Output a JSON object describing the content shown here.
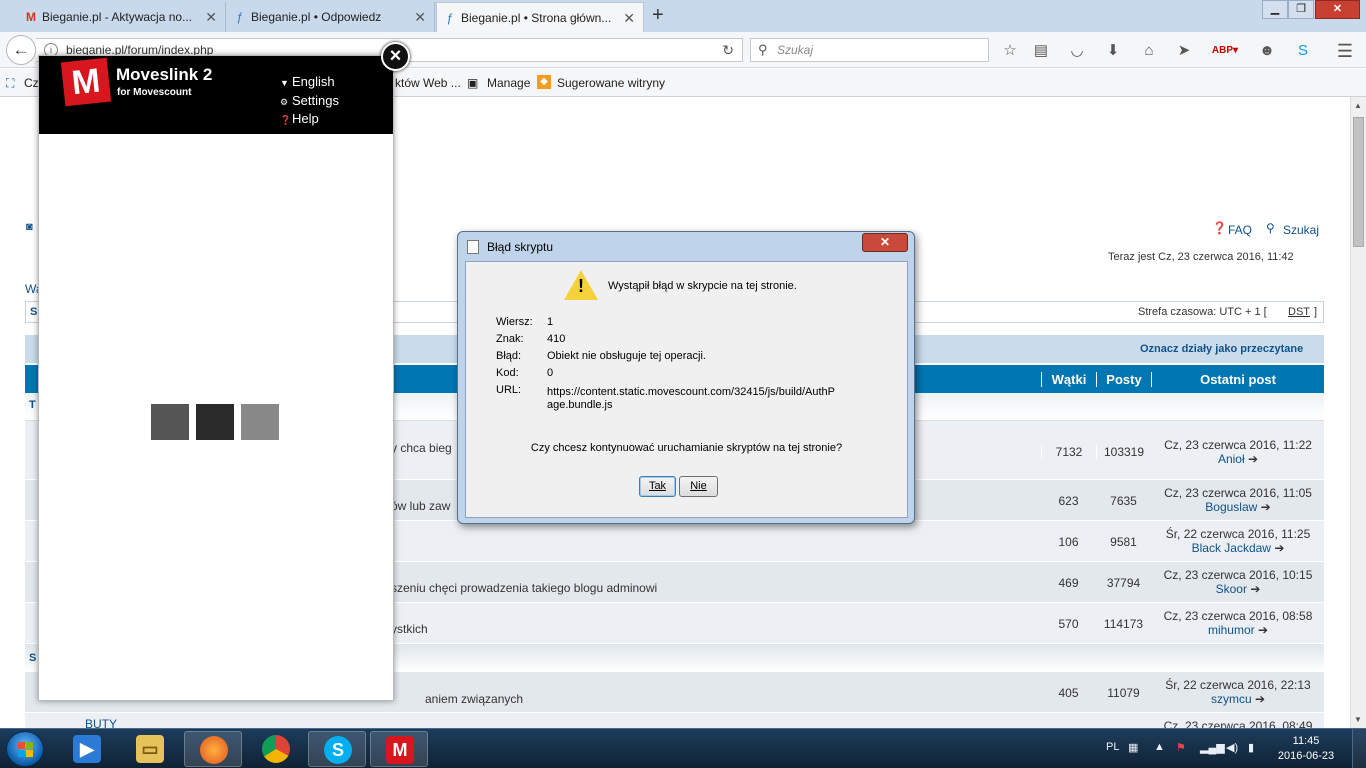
{
  "browser": {
    "tabs": [
      {
        "title": "Bieganie.pl - Aktywacja no...",
        "icon": "gmail-icon"
      },
      {
        "title": "Bieganie.pl • Odpowiedz",
        "icon": "forum-icon"
      },
      {
        "title": "Bieganie.pl • Strona główn...",
        "icon": "forum-icon"
      }
    ],
    "url": "bieganie.pl/forum/index.php",
    "search_placeholder": "Szukaj",
    "bookmarks": [
      "Cz",
      "któw Web ...",
      "Manage",
      "Sugerowane witryny"
    ]
  },
  "forum": {
    "faq": "FAQ",
    "search": "Szukaj",
    "now": "Teraz jest Cz, 23 czerwca 2016, 11:42",
    "timezone": "Strefa czasowa: UTC + 1 [",
    "dst": "DST",
    "timezone_end": "]",
    "mark_read": "Oznacz działy jako przeczytane",
    "headers": {
      "topics": "Wątki",
      "posts": "Posty",
      "last_post": "Ostatni post"
    },
    "frag_wa": "Wa",
    "frag_s": "S",
    "frag_t": "T",
    "frag_s2": "S",
    "rows": [
      {
        "desc": "y chca bieg",
        "topics": "7132",
        "posts": "103319",
        "last_date": "Cz, 23 czerwca 2016, 11:22",
        "last_user": "Anioł"
      },
      {
        "desc": "ów lub zaw",
        "topics": "623",
        "posts": "7635",
        "last_date": "Cz, 23 czerwca 2016, 11:05",
        "last_user": "Boguslaw"
      },
      {
        "desc": "",
        "topics": "106",
        "posts": "9581",
        "last_date": "Śr, 22 czerwca 2016, 11:25",
        "last_user": "Black Jackdaw"
      },
      {
        "desc": "szeniu chęci prowadzenia takiego blogu adminowi",
        "topics": "469",
        "posts": "37794",
        "last_date": "Cz, 23 czerwca 2016, 10:15",
        "last_user": "Skoor"
      },
      {
        "desc": "ystkich",
        "topics": "570",
        "posts": "114173",
        "last_date": "Cz, 23 czerwca 2016, 08:58",
        "last_user": "mihumor"
      },
      {
        "desc": "aniem związanych",
        "topics": "405",
        "posts": "11079",
        "last_date": "Śr, 22 czerwca 2016, 22:13",
        "last_user": "szymcu"
      }
    ],
    "next_forum": "BUTY",
    "next_date": "Cz, 23 czerwca 2016, 08:49"
  },
  "moveslink": {
    "logo_letter": "M",
    "title": "Moveslink 2",
    "subtitle": "for Movescount",
    "menu": [
      "English",
      "Settings",
      "Help"
    ],
    "close": "×"
  },
  "dialog": {
    "title": "Błąd skryptu",
    "message": "Wystąpił błąd w skrypcie na tej stronie.",
    "fields": [
      {
        "label": "Wiersz:",
        "value": "1"
      },
      {
        "label": "Znak:",
        "value": "410"
      },
      {
        "label": "Błąd:",
        "value": "Obiekt nie obsługuje tej operacji."
      },
      {
        "label": "Kod:",
        "value": "0"
      },
      {
        "label": "URL:",
        "value": "https://content.static.movescount.com/32415/js/build/AuthP"
      }
    ],
    "url_cont": "age.bundle.js",
    "question": "Czy chcesz kontynuować uruchamianie skryptów na tej stronie?",
    "yes": "Tak",
    "no": "Nie"
  },
  "taskbar": {
    "lang": "PL",
    "time": "11:45",
    "date": "2016-06-23"
  },
  "colors": {
    "accent": "#0076b3",
    "header_band": "#cadceb",
    "moveslink_red": "#d7161d"
  }
}
